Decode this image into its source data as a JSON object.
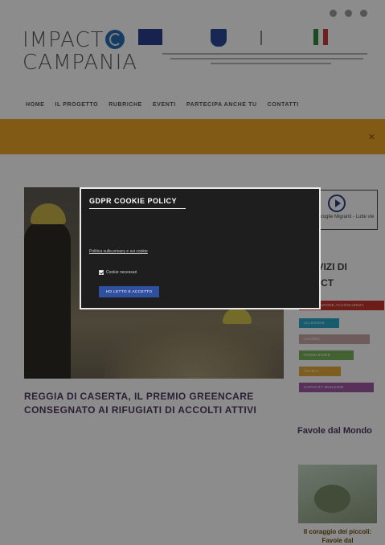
{
  "header": {
    "logo": {
      "line1": "IMPACT",
      "line2": "CAMPANIA"
    },
    "social_icons": [
      "facebook-icon",
      "instagram-icon",
      "youtube-icon"
    ],
    "nav": [
      "HOME",
      "IL PROGETTO",
      "RUBRICHE",
      "EVENTI",
      "PARTECIPA ANCHE TU",
      "CONTATTI"
    ],
    "banner_icon": "search-icon"
  },
  "article": {
    "title": "REGGIA DI CASERTA, IL PREMIO GREENCARE CONSEGNATO AI RIFUGIATI DI ACCOLTI ATTIVI"
  },
  "sidebar": {
    "radio_label": "Radio Accoglie Migranti - Lutte vie",
    "services_title": "SERVIZI DI IMPACT",
    "tags": [
      {
        "label": "INFORMAZIONE ACCOGLIENZA",
        "color": "#c9332b"
      },
      {
        "label": "ALLOGGIO",
        "color": "#2aa7c9"
      },
      {
        "label": "LAVORO",
        "color": "#c9a7a7"
      },
      {
        "label": "FORMAZIONE",
        "color": "#7ab35a"
      },
      {
        "label": "TUTELA",
        "color": "#e8a83b"
      },
      {
        "label": "CAPACITY BUILDING",
        "color": "#a05aa4"
      }
    ],
    "favole_title": "Favole dal Mondo",
    "favole_caption": "Il coraggio dei piccoli: Favole dal"
  },
  "cookie_modal": {
    "title": "GDPR COOKIE POLICY",
    "privacy_link": "Politica sulla privacy e sui cookie",
    "checkbox_label": "Cookie necessari",
    "checkbox_checked": true,
    "accept_button": "HO LETTO E ACCETTO"
  },
  "colors": {
    "banner": "#eca529",
    "title": "#4f3a63",
    "modal_bg": "#1e1e1e",
    "button": "#2f4f9f"
  }
}
